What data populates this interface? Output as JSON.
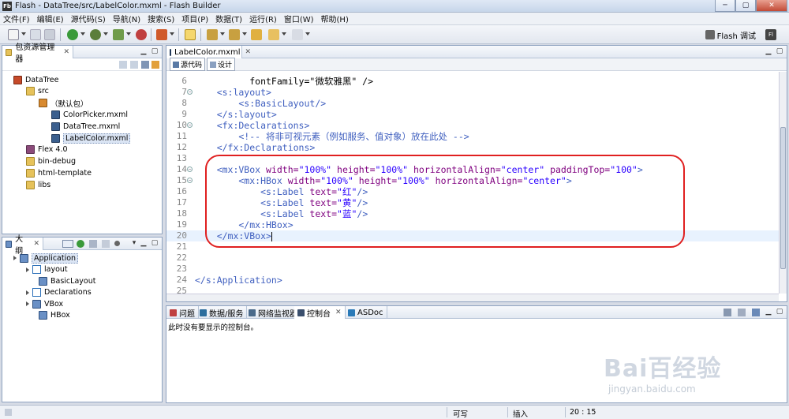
{
  "window": {
    "app_icon": "Fb",
    "title": "Flash - DataTree/src/LabelColor.mxml - Flash Builder",
    "controls": [
      "─",
      "▢",
      "✕"
    ]
  },
  "menu": [
    "文件(F)",
    "编辑(E)",
    "源代码(S)",
    "导航(N)",
    "搜索(S)",
    "项目(P)",
    "数据(T)",
    "运行(R)",
    "窗口(W)",
    "帮助(H)"
  ],
  "toolbar": {
    "perspective_label": "Flash 调试",
    "perspective_short": "Fl"
  },
  "package_explorer": {
    "tab_label": "包资源管理器",
    "tree": [
      {
        "label": "DataTree",
        "icon": "project-icon",
        "level": 0
      },
      {
        "label": "src",
        "icon": "folder-icon",
        "level": 1
      },
      {
        "label": "（默认包）",
        "icon": "package-icon",
        "level": 2
      },
      {
        "label": "ColorPicker.mxml",
        "icon": "mxml-file-icon",
        "level": 3
      },
      {
        "label": "DataTree.mxml",
        "icon": "mxml-file-icon",
        "level": 3
      },
      {
        "label": "LabelColor.mxml",
        "icon": "mxml-file-icon",
        "level": 3,
        "selected": true
      },
      {
        "label": "Flex 4.0",
        "icon": "library-icon",
        "level": 1
      },
      {
        "label": "bin-debug",
        "icon": "folder-icon",
        "level": 1
      },
      {
        "label": "html-template",
        "icon": "folder-icon",
        "level": 1
      },
      {
        "label": "libs",
        "icon": "folder-icon",
        "level": 1
      }
    ]
  },
  "outline": {
    "tab_label": "大纲",
    "tree": [
      {
        "label": "Application",
        "icon": "component-icon",
        "level": 0,
        "selected": true
      },
      {
        "label": "layout",
        "icon": "tag-icon",
        "level": 1
      },
      {
        "label": "BasicLayout",
        "icon": "component-icon",
        "level": 2
      },
      {
        "label": "Declarations",
        "icon": "tag-icon",
        "level": 1
      },
      {
        "label": "VBox",
        "icon": "vbox-icon",
        "level": 1
      },
      {
        "label": "HBox",
        "icon": "hbox-icon",
        "level": 2
      }
    ]
  },
  "editor": {
    "tab_label": "LabelColor.mxml",
    "mode_source": "源代码",
    "mode_design": "设计",
    "lines": [
      {
        "n": "6",
        "fold": false,
        "segs": [
          [
            "plain",
            "          fontFamily=\"微软雅黑\" />"
          ]
        ]
      },
      {
        "n": "7",
        "fold": true,
        "segs": [
          [
            "tagc",
            "    <s:layout>"
          ]
        ]
      },
      {
        "n": "8",
        "fold": false,
        "segs": [
          [
            "tagc",
            "        <s:BasicLayout/>"
          ]
        ]
      },
      {
        "n": "9",
        "fold": false,
        "segs": [
          [
            "tagc",
            "    </s:layout>"
          ]
        ]
      },
      {
        "n": "10",
        "fold": true,
        "segs": [
          [
            "tagc",
            "    <fx:Declarations>"
          ]
        ]
      },
      {
        "n": "11",
        "fold": false,
        "segs": [
          [
            "cmt",
            "        <!-- 将非可视元素（例如服务、值对象）放在此处 -->"
          ]
        ]
      },
      {
        "n": "12",
        "fold": false,
        "segs": [
          [
            "tagc",
            "    </fx:Declarations>"
          ]
        ]
      },
      {
        "n": "13",
        "fold": false,
        "segs": [
          [
            "plain",
            ""
          ]
        ]
      },
      {
        "n": "14",
        "fold": true,
        "segs": [
          [
            "tagc",
            "    <mx:VBox "
          ],
          [
            "attr",
            "width="
          ],
          [
            "str",
            "\"100%\""
          ],
          [
            "attr",
            " height="
          ],
          [
            "str",
            "\"100%\""
          ],
          [
            "attr",
            " horizontalAlign="
          ],
          [
            "str",
            "\"center\""
          ],
          [
            "attr",
            " paddingTop="
          ],
          [
            "str",
            "\"100\""
          ],
          [
            "tagc",
            ">"
          ]
        ]
      },
      {
        "n": "15",
        "fold": true,
        "segs": [
          [
            "tagc",
            "        <mx:HBox "
          ],
          [
            "attr",
            "width="
          ],
          [
            "str",
            "\"100%\""
          ],
          [
            "attr",
            " height="
          ],
          [
            "str",
            "\"100%\""
          ],
          [
            "attr",
            " horizontalAlign="
          ],
          [
            "str",
            "\"center\""
          ],
          [
            "tagc",
            ">"
          ]
        ]
      },
      {
        "n": "16",
        "fold": false,
        "segs": [
          [
            "tagc",
            "            <s:Label "
          ],
          [
            "attr",
            "text="
          ],
          [
            "str",
            "\"红\""
          ],
          [
            "tagc",
            "/>"
          ]
        ]
      },
      {
        "n": "17",
        "fold": false,
        "segs": [
          [
            "tagc",
            "            <s:Label "
          ],
          [
            "attr",
            "text="
          ],
          [
            "str",
            "\"黄\""
          ],
          [
            "tagc",
            "/>"
          ]
        ]
      },
      {
        "n": "18",
        "fold": false,
        "segs": [
          [
            "tagc",
            "            <s:Label "
          ],
          [
            "attr",
            "text="
          ],
          [
            "str",
            "\"蓝\""
          ],
          [
            "tagc",
            "/>"
          ]
        ]
      },
      {
        "n": "19",
        "fold": false,
        "segs": [
          [
            "tagc",
            "        </mx:HBox>"
          ]
        ]
      },
      {
        "n": "20",
        "fold": false,
        "segs": [
          [
            "tagc",
            "    </mx:VBox>"
          ]
        ],
        "current": true
      },
      {
        "n": "21",
        "fold": false,
        "segs": [
          [
            "plain",
            ""
          ]
        ]
      },
      {
        "n": "22",
        "fold": false,
        "segs": [
          [
            "plain",
            ""
          ]
        ]
      },
      {
        "n": "23",
        "fold": false,
        "segs": [
          [
            "plain",
            ""
          ]
        ]
      },
      {
        "n": "24",
        "fold": false,
        "segs": [
          [
            "tagc",
            "</s:Application>"
          ]
        ]
      },
      {
        "n": "25",
        "fold": false,
        "segs": [
          [
            "plain",
            ""
          ]
        ]
      }
    ]
  },
  "bottom_panel": {
    "tabs": [
      "问题",
      "数据/服务",
      "网络监视器",
      "控制台",
      "ASDoc"
    ],
    "active_tab": "控制台",
    "message": "此时没有要显示的控制台。"
  },
  "status": {
    "writable": "可写",
    "insert_mode": "插入",
    "position": "20 : 15"
  },
  "watermark": {
    "brand": "Bai百经验",
    "site": "jingyan.baidu.com"
  },
  "colors": {
    "highlight_box": "#e02020",
    "tag": "#3f5fbf",
    "attribute": "#7f007f",
    "string": "#2a00ff"
  }
}
